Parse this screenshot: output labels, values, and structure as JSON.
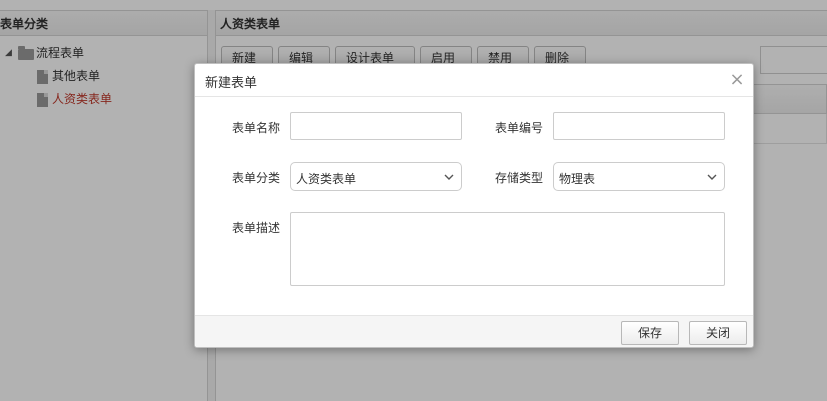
{
  "left_panel": {
    "title": "表单分类",
    "tree": {
      "root": {
        "label": "流程表单",
        "expanded_glyph": "◢"
      },
      "children": [
        {
          "label": "其他表单"
        },
        {
          "label": "人资类表单"
        }
      ]
    }
  },
  "right_panel": {
    "title": "人资类表单",
    "toolbar": {
      "new": "新建",
      "edit": "编辑",
      "design": "设计表单",
      "enable": "启用",
      "disable": "禁用",
      "delete": "删除"
    }
  },
  "dialog": {
    "title": "新建表单",
    "close_glyph": "×",
    "fields": {
      "form_name_label": "表单名称",
      "form_name_value": "",
      "form_code_label": "表单编号",
      "form_code_value": "",
      "category_label": "表单分类",
      "category_value": "人资类表单",
      "storage_label": "存储类型",
      "storage_value": "物理表",
      "description_label": "表单描述",
      "description_value": ""
    },
    "buttons": {
      "save": "保存",
      "close": "关闭"
    }
  },
  "colors": {
    "active_tree_item": "#c0392b",
    "overlay": "rgba(0,0,0,0.30)"
  }
}
